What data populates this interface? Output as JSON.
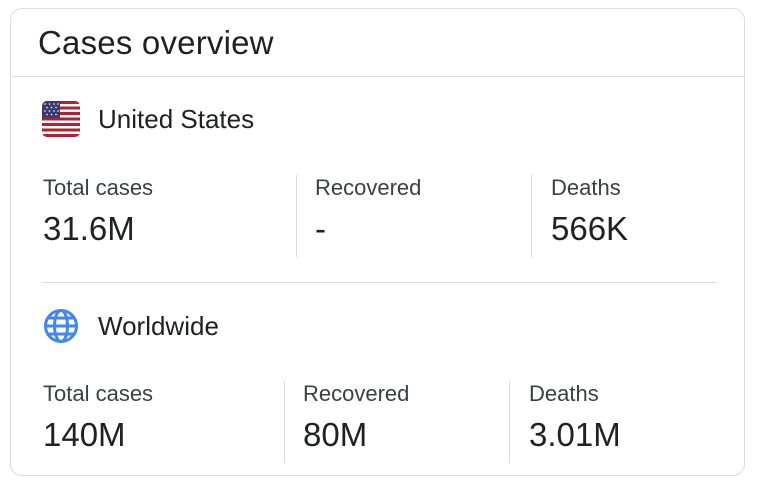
{
  "card": {
    "title": "Cases overview"
  },
  "sections": [
    {
      "name": "United States",
      "icon": "us-flag-icon",
      "stats": [
        {
          "label": "Total cases",
          "value": "31.6M"
        },
        {
          "label": "Recovered",
          "value": "-"
        },
        {
          "label": "Deaths",
          "value": "566K"
        }
      ]
    },
    {
      "name": "Worldwide",
      "icon": "globe-icon",
      "stats": [
        {
          "label": "Total cases",
          "value": "140M"
        },
        {
          "label": "Recovered",
          "value": "80M"
        },
        {
          "label": "Deaths",
          "value": "3.01M"
        }
      ]
    }
  ],
  "colors": {
    "text_primary": "#202124",
    "text_secondary": "#3c4043",
    "divider": "#dadce0",
    "globe_blue": "#4285f4",
    "flag_red": "#b22234",
    "flag_blue": "#3c3b6e"
  }
}
